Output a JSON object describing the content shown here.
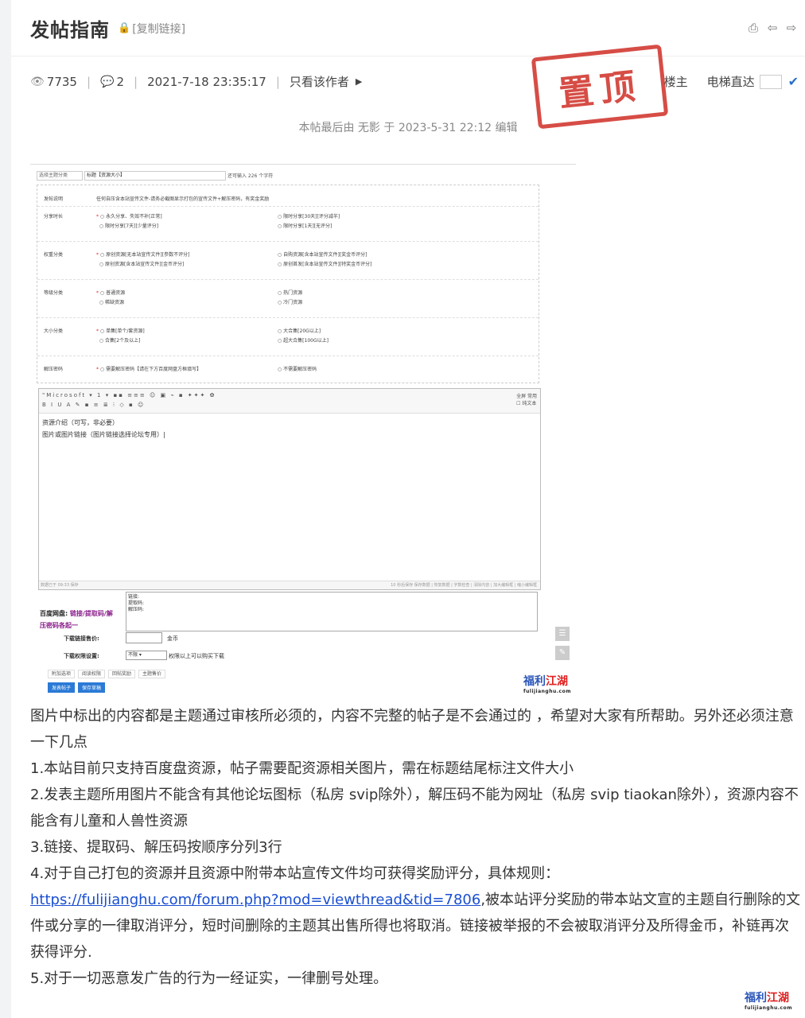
{
  "header": {
    "title": "发帖指南",
    "copy_link": "[复制链接]",
    "actions": [
      "⎙",
      "⇦",
      "⇨"
    ]
  },
  "meta": {
    "views": "7735",
    "replies": "2",
    "datetime": "2021-7-18 23:35:17",
    "only_author": "只看该作者"
  },
  "stamp": "置顶",
  "right_meta": {
    "floor": "楼主",
    "elevator": "电梯直达"
  },
  "edit_note": "本帖最后由 无影 于 2023-5-31 22:12 编辑",
  "shot": {
    "select_category": "选择主题分类",
    "title_value": "标题【资源大小】",
    "remain": "还可输入 226 个字符",
    "rows": [
      {
        "label": "发帖说明",
        "c1": "任何自压含本站宣传文件-请务必截图显示打包的宣传文件+解压密码，有奖金奖励",
        "c2": ""
      },
      {
        "label": "分享时长",
        "c1": "永久分享、失效不补[正常]",
        "c2": "限时分享[30天][评分减半]"
      },
      {
        "label": "",
        "c1": "限时分享[7天][少量评分]",
        "c2": "限时分享[1天][无评分]"
      },
      {
        "label": "权重分类",
        "c1": "原创资源[无本站宣传文件][参数不评分]",
        "c2": "自购资源[含本站宣传文件][奖金币评分]"
      },
      {
        "label": "",
        "c1": "原创资源[含本站宣传文件][金币评分]",
        "c2": "原创首发[含本站宣传文件][特奖金币评分]"
      },
      {
        "label": "等级分类",
        "c1": "普通资源",
        "c2": "热门资源"
      },
      {
        "label": "",
        "c1": "稀缺资源",
        "c2": "冷门资源"
      },
      {
        "label": "大小分类",
        "c1": "单集[单个/套资源]",
        "c2": "大合集[20G以上]"
      },
      {
        "label": "",
        "c1": "合集[2个及以上]",
        "c2": "超大合集[100G以上]"
      },
      {
        "label": "解压密码",
        "c1": "需要解压密码【请在下方百度网盘方框填写】",
        "c2": "不需要解压密码"
      }
    ],
    "editor_font": "\"Microsoft",
    "editor_size": "1",
    "editor_line1": "资源介绍（可写，非必要）",
    "editor_line2": "图片或图片链接（图片链接选择论坛专用）|",
    "editor_status_left": "数据已于 09:33 保存",
    "editor_status_right": "10 秒后保存 保存数据 | 恢复数据 | 字数检查 | 清除内容 | 加大编辑框 | 缩小编辑框",
    "tb_right": "全屏  常用",
    "tb_right2": "纯文本",
    "bd_label_a": "百度网盘:",
    "bd_label_b": "链接/提取码/解压密码各起一",
    "bd_box": [
      "链接:",
      "提取码:",
      "解压码:"
    ],
    "price_label": "下载链接售价:",
    "price_unit": "金币",
    "perm_label": "下载权限设置:",
    "perm_value": "不限",
    "perm_text": "权限以上可以购买下载",
    "options": [
      "附加选项",
      "阅读权限",
      "回帖奖励",
      "主题售价"
    ],
    "buttons": [
      "发表帖子",
      "保存草稿"
    ],
    "watermark_a": "福利",
    "watermark_b": "江湖",
    "watermark_url": "fulijianghu.com"
  },
  "body": {
    "p1": "图片中标出的内容都是主题通过审核所必须的，内容不完整的帖子是不会通过的 ，希望对大家有所帮助。另外还必须注意一下几点",
    "p2": "1.本站目前只支持百度盘资源，帖子需要配资源相关图片，需在标题结尾标注文件大小",
    "p3": "2.发表主题所用图片不能含有其他论坛图标（私房 svip除外），解压码不能为网址（私房 svip tiaokan除外），资源内容不能含有儿童和人兽性资源",
    "p4": "3.链接、提取码、解压码按顺序分列3行",
    "p5": "4.对于自己打包的资源并且资源中附带本站宣传文件均可获得奖励评分，具体规则：",
    "link": "https://fulijianghu.com/forum.php?mod=viewthread&tid=7806",
    "p6": ",被本站评分奖励的带本站文宣的主题自行删除的文件或分享的一律取消评分，短时间删除的主题其出售所得也将取消。链接被举报的不会被取消评分及所得金币，补链再次获得评分.",
    "p7": "5.对于一切恶意发广告的行为一经证实，一律删号处理。"
  }
}
